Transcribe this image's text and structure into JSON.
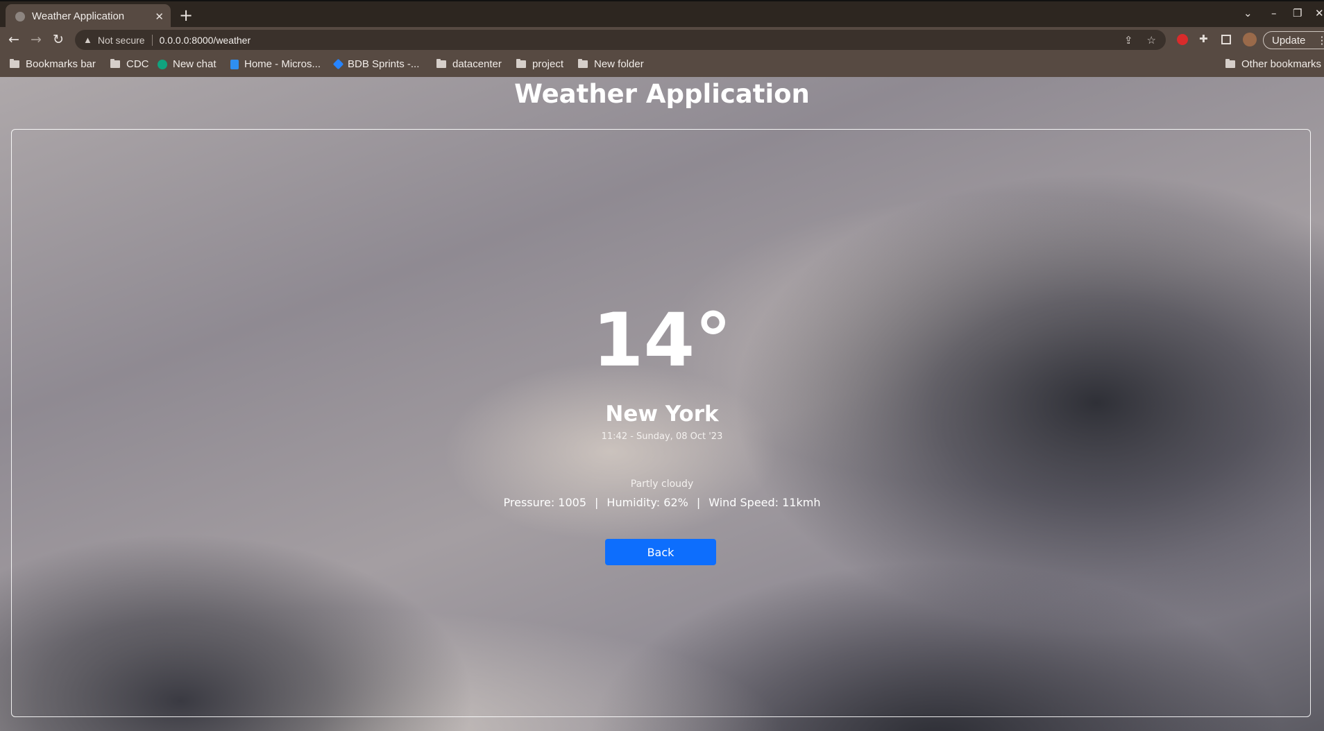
{
  "browser": {
    "tab": {
      "title": "Weather Application"
    },
    "new_tab_symbol": "+",
    "address": {
      "security_label": "Not secure",
      "url": "0.0.0.0:8000/weather"
    },
    "update_label": "Update",
    "bookmarks": [
      {
        "label": "Bookmarks bar",
        "kind": "folder"
      },
      {
        "label": "CDC",
        "kind": "folder"
      },
      {
        "label": "New chat",
        "kind": "site",
        "icon": "chatgpt-icon",
        "color": "#10a37f"
      },
      {
        "label": "Home - Micros...",
        "kind": "site",
        "icon": "azure-icon",
        "color": "#2f8ff0"
      },
      {
        "label": "BDB Sprints -...",
        "kind": "site",
        "icon": "jira-icon",
        "color": "#2684ff"
      },
      {
        "label": "datacenter",
        "kind": "folder"
      },
      {
        "label": "project",
        "kind": "folder"
      },
      {
        "label": "New folder",
        "kind": "folder"
      }
    ],
    "other_bookmarks": "Other bookmarks"
  },
  "page": {
    "title": "Weather Application",
    "temperature": "14°",
    "city": "New York",
    "datetime": "11:42 - Sunday, 08 Oct '23",
    "condition": "Partly cloudy",
    "pressure": "Pressure: 1005",
    "humidity": "Humidity: 62%",
    "wind": "Wind Speed: 11kmh",
    "separator": "|",
    "back_label": "Back"
  },
  "colors": {
    "accent": "#0d6efd",
    "chrome": "#574a42",
    "tabstrip": "#2d2620"
  }
}
